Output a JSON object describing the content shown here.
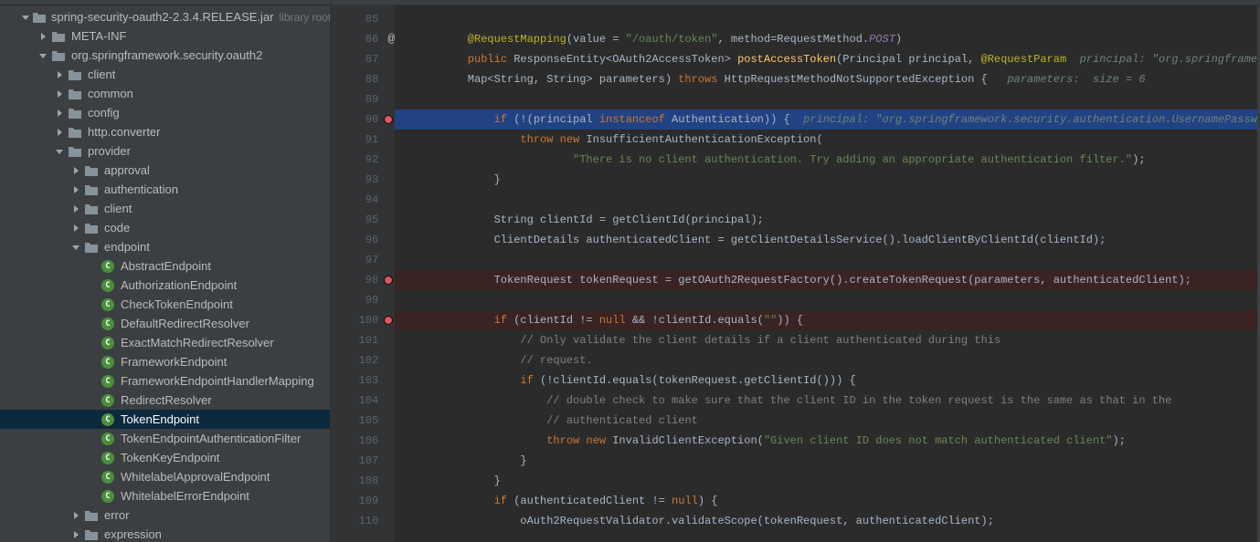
{
  "tree": {
    "root_label": "spring-security-oauth2-2.3.4.RELEASE.jar",
    "root_suffix": "library root",
    "items": [
      {
        "depth": 1,
        "expand": "down",
        "icon": "folder",
        "label": "spring-security-oauth2-2.3.4.RELEASE.jar",
        "suffix": "library root"
      },
      {
        "depth": 2,
        "expand": "right",
        "icon": "folder",
        "label": "META-INF"
      },
      {
        "depth": 2,
        "expand": "down",
        "icon": "folder",
        "label": "org.springframework.security.oauth2"
      },
      {
        "depth": 3,
        "expand": "right",
        "icon": "folder",
        "label": "client"
      },
      {
        "depth": 3,
        "expand": "right",
        "icon": "folder",
        "label": "common"
      },
      {
        "depth": 3,
        "expand": "right",
        "icon": "folder",
        "label": "config"
      },
      {
        "depth": 3,
        "expand": "right",
        "icon": "folder",
        "label": "http.converter"
      },
      {
        "depth": 3,
        "expand": "down",
        "icon": "folder",
        "label": "provider"
      },
      {
        "depth": 4,
        "expand": "right",
        "icon": "folder",
        "label": "approval"
      },
      {
        "depth": 4,
        "expand": "right",
        "icon": "folder",
        "label": "authentication"
      },
      {
        "depth": 4,
        "expand": "right",
        "icon": "folder",
        "label": "client"
      },
      {
        "depth": 4,
        "expand": "right",
        "icon": "folder",
        "label": "code"
      },
      {
        "depth": 4,
        "expand": "down",
        "icon": "folder",
        "label": "endpoint"
      },
      {
        "depth": 5,
        "expand": "",
        "icon": "class",
        "label": "AbstractEndpoint"
      },
      {
        "depth": 5,
        "expand": "",
        "icon": "class",
        "label": "AuthorizationEndpoint"
      },
      {
        "depth": 5,
        "expand": "",
        "icon": "class",
        "label": "CheckTokenEndpoint"
      },
      {
        "depth": 5,
        "expand": "",
        "icon": "class",
        "label": "DefaultRedirectResolver"
      },
      {
        "depth": 5,
        "expand": "",
        "icon": "class",
        "label": "ExactMatchRedirectResolver"
      },
      {
        "depth": 5,
        "expand": "",
        "icon": "class",
        "label": "FrameworkEndpoint"
      },
      {
        "depth": 5,
        "expand": "",
        "icon": "class",
        "label": "FrameworkEndpointHandlerMapping"
      },
      {
        "depth": 5,
        "expand": "",
        "icon": "class",
        "label": "RedirectResolver"
      },
      {
        "depth": 5,
        "expand": "",
        "icon": "class",
        "label": "TokenEndpoint",
        "selected": true
      },
      {
        "depth": 5,
        "expand": "",
        "icon": "class",
        "label": "TokenEndpointAuthenticationFilter"
      },
      {
        "depth": 5,
        "expand": "",
        "icon": "class",
        "label": "TokenKeyEndpoint"
      },
      {
        "depth": 5,
        "expand": "",
        "icon": "class",
        "label": "WhitelabelApprovalEndpoint"
      },
      {
        "depth": 5,
        "expand": "",
        "icon": "class",
        "label": "WhitelabelErrorEndpoint"
      },
      {
        "depth": 4,
        "expand": "right",
        "icon": "folder",
        "label": "error"
      },
      {
        "depth": 4,
        "expand": "right",
        "icon": "folder",
        "label": "expression"
      }
    ]
  },
  "editor": {
    "lines": [
      {
        "n": 85,
        "html": ""
      },
      {
        "n": 86,
        "html": "        <span class='anno'>@RequestMapping</span><span class='pl'>(value = </span><span class='str'>\"/oauth/token\"</span><span class='pl'>, method=RequestMethod.</span><span class='stat'>POST</span><span class='pl'>)</span>",
        "mark": "at"
      },
      {
        "n": 87,
        "html": "        <span class='kw'>public</span><span class='pl'> ResponseEntity&lt;OAuth2AccessToken&gt; </span><span class='fn'>postAccessToken</span><span class='pl'>(Principal principal, </span><span class='anno'>@RequestParam</span>  <span class='hint'>principal: \"org.springframe</span>"
      },
      {
        "n": 88,
        "html": "        <span class='pl'>Map&lt;String, String&gt; parameters) </span><span class='kw'>throws</span><span class='pl'> HttpRequestMethodNotSupportedException {   </span><span class='hint'>parameters:  size = 6</span>"
      },
      {
        "n": 89,
        "html": ""
      },
      {
        "n": 90,
        "html": "            <span class='kw'>if</span><span class='pl'> (!(principal </span><span class='kw'>instanceof</span><span class='pl'> Authentication)) {  </span><span class='hint'>principal: \"org.springframework.security.authentication.UsernamePassw</span>",
        "hl": "blue",
        "mark": "bp",
        "bulb": true
      },
      {
        "n": 91,
        "html": "                <span class='kw'>throw new</span><span class='pl'> InsufficientAuthenticationException(</span>"
      },
      {
        "n": 92,
        "html": "                        <span class='str'>\"There is no client authentication. Try adding an appropriate authentication filter.\"</span><span class='pl'>);</span>"
      },
      {
        "n": 93,
        "html": "            <span class='pl'>}</span>"
      },
      {
        "n": 94,
        "html": ""
      },
      {
        "n": 95,
        "html": "            <span class='pl'>String clientId = getClientId(principal);</span>"
      },
      {
        "n": 96,
        "html": "            <span class='pl'>ClientDetails authenticatedClient = getClientDetailsService().loadClientByClientId(clientId);</span>"
      },
      {
        "n": 97,
        "html": ""
      },
      {
        "n": 98,
        "html": "            <span class='pl'>TokenRequest tokenRequest = getOAuth2RequestFactory().createTokenRequest(parameters, authenticatedClient);</span>",
        "hl": "dark",
        "mark": "bp"
      },
      {
        "n": 99,
        "html": ""
      },
      {
        "n": 100,
        "html": "            <span class='kw'>if</span><span class='pl'> (clientId != </span><span class='kw'>null</span><span class='pl'> &amp;&amp; !clientId.equals(</span><span class='str'>\"\"</span><span class='pl'>)) {</span>",
        "hl": "dark",
        "mark": "bp"
      },
      {
        "n": 101,
        "html": "                <span class='cmt'>// Only validate the client details if a client authenticated during this</span>"
      },
      {
        "n": 102,
        "html": "                <span class='cmt'>// request.</span>"
      },
      {
        "n": 103,
        "html": "                <span class='kw'>if</span><span class='pl'> (!clientId.equals(tokenRequest.getClientId())) {</span>"
      },
      {
        "n": 104,
        "html": "                    <span class='cmt'>// double check to make sure that the client ID in the token request is the same as that in the</span>"
      },
      {
        "n": 105,
        "html": "                    <span class='cmt'>// authenticated client</span>"
      },
      {
        "n": 106,
        "html": "                    <span class='kw'>throw new</span><span class='pl'> InvalidClientException(</span><span class='str'>\"Given client ID does not match authenticated client\"</span><span class='pl'>);</span>"
      },
      {
        "n": 107,
        "html": "                <span class='pl'>}</span>"
      },
      {
        "n": 108,
        "html": "            <span class='pl'>}</span>"
      },
      {
        "n": 109,
        "html": "            <span class='kw'>if</span><span class='pl'> (authenticatedClient != </span><span class='kw'>null</span><span class='pl'>) {</span>"
      },
      {
        "n": 110,
        "html": "                <span class='pl'>oAuth2RequestValidator.validateScope(tokenRequest, authenticatedClient);</span>"
      }
    ]
  }
}
